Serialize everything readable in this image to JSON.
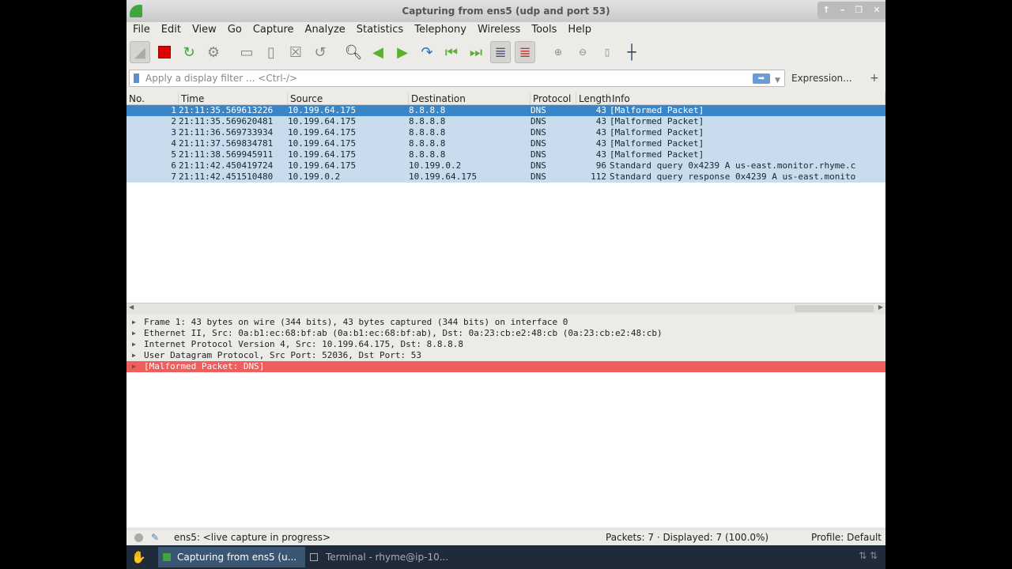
{
  "window": {
    "title": "Capturing from ens5 (udp and port 53)"
  },
  "menu": [
    "File",
    "Edit",
    "View",
    "Go",
    "Capture",
    "Analyze",
    "Statistics",
    "Telephony",
    "Wireless",
    "Tools",
    "Help"
  ],
  "filter": {
    "placeholder": "Apply a display filter ... <Ctrl-/>",
    "expression_label": "Expression...",
    "add_label": "+"
  },
  "columns": [
    "No.",
    "Time",
    "Source",
    "Destination",
    "Protocol",
    "Length",
    "Info"
  ],
  "packets": [
    [
      "1",
      "21:11:35.569613226",
      "10.199.64.175",
      "8.8.8.8",
      "DNS",
      "43",
      "[Malformed Packet]"
    ],
    [
      "2",
      "21:11:35.569620481",
      "10.199.64.175",
      "8.8.8.8",
      "DNS",
      "43",
      "[Malformed Packet]"
    ],
    [
      "3",
      "21:11:36.569733934",
      "10.199.64.175",
      "8.8.8.8",
      "DNS",
      "43",
      "[Malformed Packet]"
    ],
    [
      "4",
      "21:11:37.569834781",
      "10.199.64.175",
      "8.8.8.8",
      "DNS",
      "43",
      "[Malformed Packet]"
    ],
    [
      "5",
      "21:11:38.569945911",
      "10.199.64.175",
      "8.8.8.8",
      "DNS",
      "43",
      "[Malformed Packet]"
    ],
    [
      "6",
      "21:11:42.450419724",
      "10.199.64.175",
      "10.199.0.2",
      "DNS",
      "96",
      "Standard query 0x4239 A us-east.monitor.rhyme.c"
    ],
    [
      "7",
      "21:11:42.451510480",
      "10.199.0.2",
      "10.199.64.175",
      "DNS",
      "112",
      "Standard query response 0x4239 A us-east.monito"
    ]
  ],
  "details": [
    "Frame 1: 43 bytes on wire (344 bits), 43 bytes captured (344 bits) on interface 0",
    "Ethernet II, Src: 0a:b1:ec:68:bf:ab (0a:b1:ec:68:bf:ab), Dst: 0a:23:cb:e2:48:cb (0a:23:cb:e2:48:cb)",
    "Internet Protocol Version 4, Src: 10.199.64.175, Dst: 8.8.8.8",
    "User Datagram Protocol, Src Port: 52036, Dst Port: 53",
    "[Malformed Packet: DNS]"
  ],
  "status": {
    "capture": "ens5: <live capture in progress>",
    "packets": "Packets: 7 · Displayed: 7 (100.0%)",
    "profile": "Profile: Default"
  },
  "taskbar": {
    "task1": "Capturing from ens5 (u...",
    "task2": "Terminal - rhyme@ip-10..."
  }
}
